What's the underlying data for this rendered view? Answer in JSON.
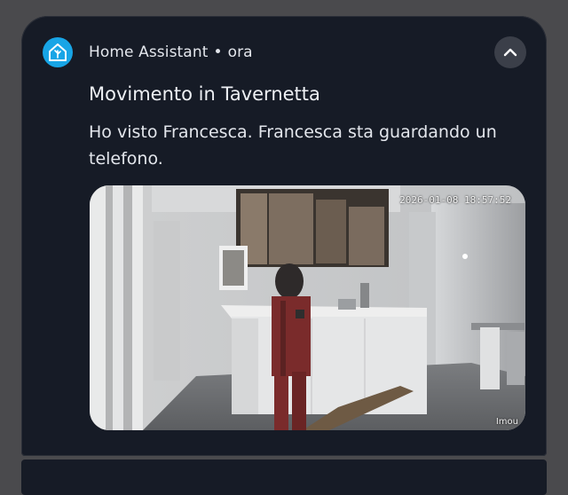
{
  "notification": {
    "app_name": "Home Assistant",
    "separator": "•",
    "time": "ora",
    "title": "Movimento in Tavernetta",
    "message": "Ho visto Francesca. Francesca sta guardando un telefono.",
    "accent_color": "#18a5e6"
  },
  "camera": {
    "timestamp": "2026-01-08 18:57:52",
    "brand": "Imou"
  },
  "icons": {
    "app": "home-assistant-icon",
    "collapse": "chevron-up-icon"
  }
}
